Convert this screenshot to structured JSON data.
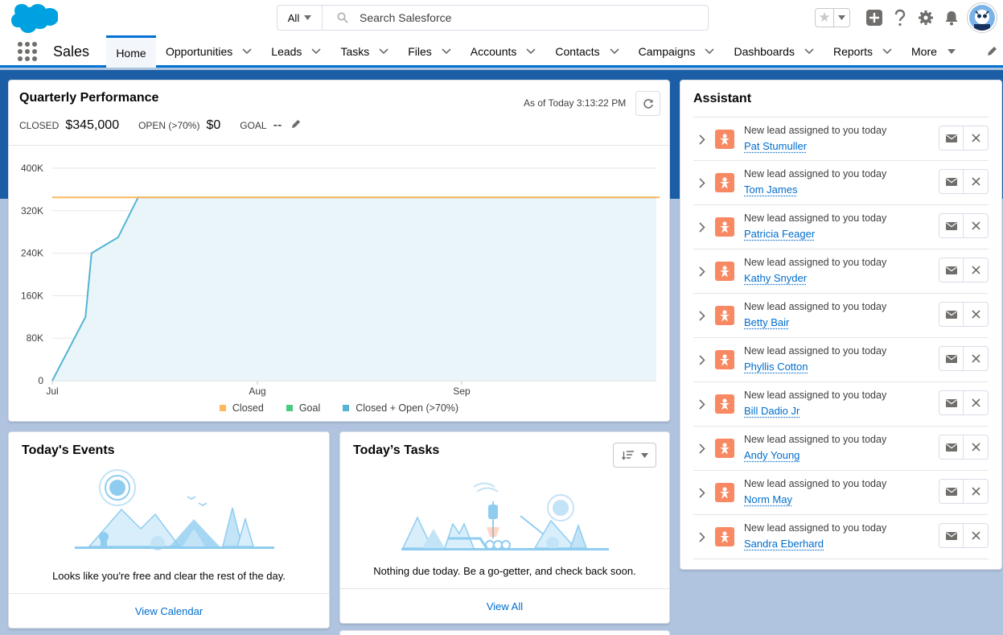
{
  "header": {
    "search_scope": "All",
    "search_placeholder": "Search Salesforce",
    "icons": [
      "salesforce-cloud-logo",
      "favorites-star-icon",
      "add-icon",
      "help-icon",
      "setup-gear-icon",
      "notifications-bell-icon",
      "user-avatar"
    ]
  },
  "nav": {
    "app_name": "Sales",
    "home": "Home",
    "tabs": [
      "Opportunities",
      "Leads",
      "Tasks",
      "Files",
      "Accounts",
      "Contacts",
      "Campaigns",
      "Dashboards",
      "Reports",
      "More"
    ]
  },
  "quarterly": {
    "title": "Quarterly Performance",
    "as_of": "As of Today 3:13:22 PM",
    "closed_label": "CLOSED",
    "closed_value": "$345,000",
    "open_label": "OPEN (>70%)",
    "open_value": "$0",
    "goal_label": "GOAL",
    "goal_value": "--"
  },
  "chart_data": {
    "type": "line",
    "y_ticks": [
      "400K",
      "320K",
      "240K",
      "160K",
      "80K",
      "0"
    ],
    "x_ticks": [
      "Jul",
      "Aug",
      "Sep"
    ],
    "ylim": [
      0,
      400000
    ],
    "series": [
      {
        "name": "Closed",
        "color": "#ffb75d",
        "points": [
          [
            0,
            345000
          ],
          [
            1,
            345000
          ]
        ]
      },
      {
        "name": "Goal",
        "color": "#4bca81",
        "points": []
      },
      {
        "name": "Closed + Open (>70%)",
        "color": "#54b4d3",
        "points": [
          [
            0,
            0
          ],
          [
            0.055,
            120000
          ],
          [
            0.065,
            240000
          ],
          [
            0.109,
            270000
          ],
          [
            0.142,
            345000
          ],
          [
            1,
            345000
          ]
        ]
      }
    ],
    "legend": [
      "Closed",
      "Goal",
      "Closed + Open (>70%)"
    ]
  },
  "events": {
    "title": "Today's Events",
    "empty_message": "Looks like you're free and clear the rest of the day.",
    "footer_link": "View Calendar"
  },
  "tasks": {
    "title": "Today’s Tasks",
    "empty_message": "Nothing due today. Be a go-getter, and check back soon.",
    "footer_link": "View All"
  },
  "assistant": {
    "title": "Assistant",
    "items": [
      {
        "text": "New lead assigned to you today",
        "name": "Pat Stumuller"
      },
      {
        "text": "New lead assigned to you today",
        "name": "Tom James"
      },
      {
        "text": "New lead assigned to you today",
        "name": "Patricia Feager"
      },
      {
        "text": "New lead assigned to you today",
        "name": "Kathy Snyder"
      },
      {
        "text": "New lead assigned to you today",
        "name": "Betty Bair"
      },
      {
        "text": "New lead assigned to you today",
        "name": "Phyllis Cotton"
      },
      {
        "text": "New lead assigned to you today",
        "name": "Bill Dadio Jr"
      },
      {
        "text": "New lead assigned to you today",
        "name": "Andy Young"
      },
      {
        "text": "New lead assigned to you today",
        "name": "Norm May"
      },
      {
        "text": "New lead assigned to you today",
        "name": "Sandra Eberhard"
      }
    ]
  },
  "colors": {
    "brand": "#0070d2",
    "link": "#006dcc",
    "lead_icon": "#f88962",
    "background": "#b0c4df"
  }
}
